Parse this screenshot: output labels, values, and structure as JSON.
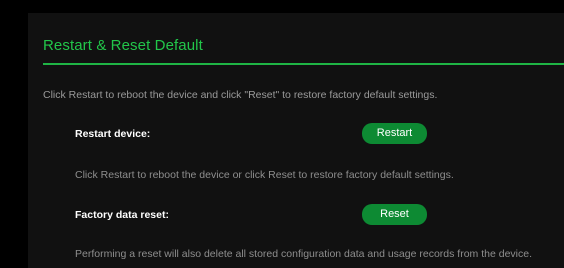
{
  "section": {
    "title": "Restart & Reset Default",
    "description": "Click Restart to reboot the device and click \"Reset\" to restore factory default settings."
  },
  "restart": {
    "label": "Restart device:",
    "button_label": "Restart",
    "help": "Click Restart to reboot the device or click Reset to restore factory default settings."
  },
  "reset": {
    "label": "Factory data reset:",
    "button_label": "Reset",
    "help": "Performing a reset will also delete all stored configuration data and usage records from the device."
  },
  "colors": {
    "accent": "#22c64a",
    "button_bg": "#0d8a33",
    "panel_bg": "#111111"
  }
}
